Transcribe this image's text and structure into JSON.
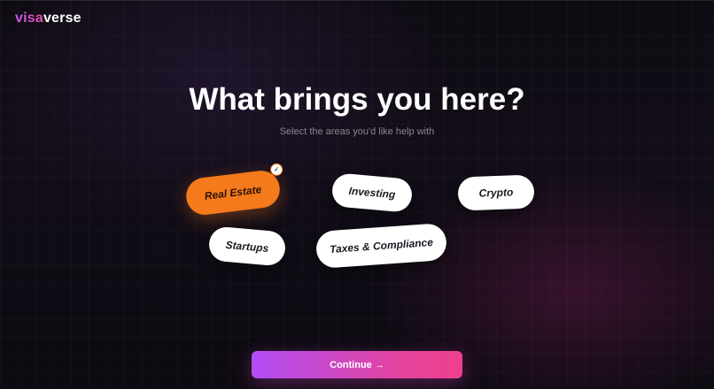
{
  "brand": {
    "part1": "visa",
    "part2": "verse"
  },
  "heading": {
    "title": "What brings you here?",
    "subtitle": "Select the areas you'd like help with"
  },
  "options": [
    {
      "label": "Real Estate",
      "selected": true
    },
    {
      "label": "Investing",
      "selected": false
    },
    {
      "label": "Crypto",
      "selected": false
    },
    {
      "label": "Startups",
      "selected": false
    },
    {
      "label": "Taxes & Compliance",
      "selected": false
    }
  ],
  "check_glyph": "✓",
  "continue_label": "Continue →",
  "colors": {
    "accent_selected": "#f47a1c",
    "button_gradient_start": "#b14df5",
    "button_gradient_end": "#ee3f8e",
    "background": "#0c0a10"
  }
}
